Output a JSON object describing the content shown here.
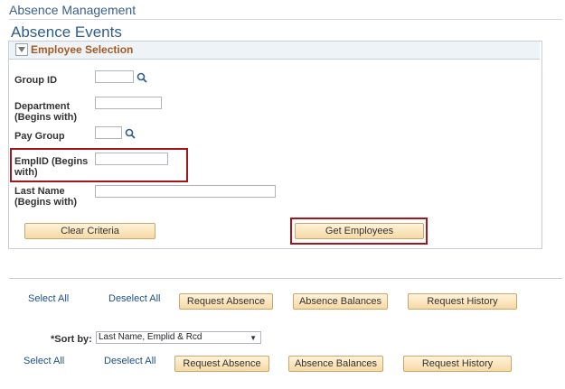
{
  "header": {
    "title": "Absence Management"
  },
  "page": {
    "title": "Absence Events"
  },
  "employee_selection": {
    "title": "Employee Selection",
    "fields": {
      "group_id": "Group ID",
      "department_line1": "Department",
      "department_line2": "(Begins with)",
      "pay_group": "Pay Group",
      "emplid_line1": "EmplID (Begins",
      "emplid_line2": "with)",
      "last_name_line1": "Last Name",
      "last_name_line2": "(Begins with)"
    },
    "values": {
      "group_id": "",
      "department": "",
      "pay_group": "",
      "emplid": "",
      "last_name": ""
    },
    "clear_criteria_label": "Clear Criteria",
    "get_employees_label": "Get Employees"
  },
  "actions_top": {
    "select_all": "Select All",
    "deselect_all": "Deselect All",
    "request_absence": "Request Absence",
    "absence_balances": "Absence Balances",
    "request_history": "Request History"
  },
  "sort": {
    "label": "*Sort by:",
    "selected": "Last Name, Emplid & Rcd"
  },
  "actions_bottom": {
    "select_all": "Select All",
    "deselect_all": "Deselect All",
    "request_absence": "Request Absence",
    "absence_balances": "Absence Balances",
    "request_history": "Request History"
  },
  "colors": {
    "highlight": "#a3161b",
    "section_title": "#a35b21",
    "link": "#1d4f8a"
  },
  "icons": [
    "search-icon",
    "collapse-triangle-icon",
    "dropdown-arrow-icon"
  ]
}
